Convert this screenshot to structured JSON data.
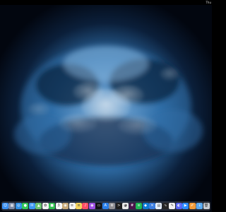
{
  "menubar": {
    "status_text": "Thu"
  },
  "wallpaper": {
    "colors": {
      "sky_dark": "#02060f",
      "cloud_dark": "#0b1f3a",
      "cloud_mid": "#2f6ea8",
      "cloud_light": "#9cc8ee",
      "glow": "#e6f4ff"
    }
  },
  "dock": {
    "apps": [
      {
        "name": "finder-icon",
        "color": "#3b8ff0",
        "glyph": "☺"
      },
      {
        "name": "launchpad-icon",
        "color": "#7c8aa5",
        "glyph": "▦"
      },
      {
        "name": "safari-icon",
        "color": "#2f8fe6",
        "glyph": "◎"
      },
      {
        "name": "messages-icon",
        "color": "#33c659",
        "glyph": "●"
      },
      {
        "name": "mail-icon",
        "color": "#3c97f3",
        "glyph": "✉"
      },
      {
        "name": "maps-icon",
        "color": "#6cc36f",
        "glyph": "▲"
      },
      {
        "name": "photos-icon",
        "color": "#f1f1f1",
        "glyph": "✿"
      },
      {
        "name": "facetime-icon",
        "color": "#2fbf4e",
        "glyph": "■"
      },
      {
        "name": "calendar-icon",
        "color": "#f7f7f7",
        "glyph": "3"
      },
      {
        "name": "contacts-icon",
        "color": "#c7a979",
        "glyph": "◉"
      },
      {
        "name": "reminders-icon",
        "color": "#f5f5f5",
        "glyph": "≡"
      },
      {
        "name": "notes-icon",
        "color": "#f4d35e",
        "glyph": "≡"
      },
      {
        "name": "music-icon",
        "color": "#fa4d63",
        "glyph": "♪"
      },
      {
        "name": "podcasts-icon",
        "color": "#9c4ee0",
        "glyph": "◉"
      },
      {
        "name": "tv-icon",
        "color": "#111111",
        "glyph": "▭"
      },
      {
        "name": "app-store-icon",
        "color": "#2a7fe8",
        "glyph": "A"
      },
      {
        "name": "system-preferences-icon",
        "color": "#8e8e93",
        "glyph": "⚙"
      },
      {
        "name": "terminal-icon",
        "color": "#1d1d1d",
        "glyph": ">"
      },
      {
        "name": "chrome-icon",
        "color": "#e9e9e9",
        "glyph": "◕"
      },
      {
        "name": "slack-icon",
        "color": "#4a154b",
        "glyph": "#"
      },
      {
        "name": "spotify-icon",
        "color": "#1db954",
        "glyph": "≋"
      },
      {
        "name": "vscode-icon",
        "color": "#0e7ad3",
        "glyph": "◆"
      },
      {
        "name": "xcode-icon",
        "color": "#3b7de0",
        "glyph": "✕"
      },
      {
        "name": "preview-icon",
        "color": "#e7f0fb",
        "glyph": "▤"
      },
      {
        "name": "activity-monitor-icon",
        "color": "#262626",
        "glyph": "∿"
      },
      {
        "name": "textedit-icon",
        "color": "#f0f0f0",
        "glyph": "✎"
      },
      {
        "name": "discord-icon",
        "color": "#5865f2",
        "glyph": "◐"
      },
      {
        "name": "zoom-icon",
        "color": "#2d8cff",
        "glyph": "▶"
      },
      {
        "name": "pages-icon",
        "color": "#f29b38",
        "glyph": "✐"
      }
    ],
    "trailing": [
      {
        "name": "downloads-folder-icon",
        "color": "#5aa9f0",
        "glyph": "↓"
      },
      {
        "name": "trash-icon",
        "color": "#c8ccd2",
        "glyph": "🗑"
      }
    ]
  }
}
